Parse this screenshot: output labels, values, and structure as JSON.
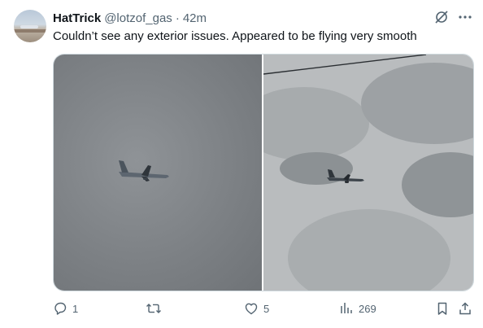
{
  "post": {
    "author_name": "HatTrick",
    "handle": "@lotzof_gas",
    "separator": "·",
    "time": "42m",
    "text": "Couldn’t see any exterior issues. Appeared to be flying very smooth"
  },
  "icons": {
    "grok": "grok-slash-icon",
    "more": "more-dots-icon"
  },
  "actions": {
    "reply_count": "1",
    "repost_count": "",
    "like_count": "5",
    "views_count": "269"
  },
  "colors": {
    "text_primary": "#0f1419",
    "text_secondary": "#536471",
    "border": "#cfd9de"
  }
}
